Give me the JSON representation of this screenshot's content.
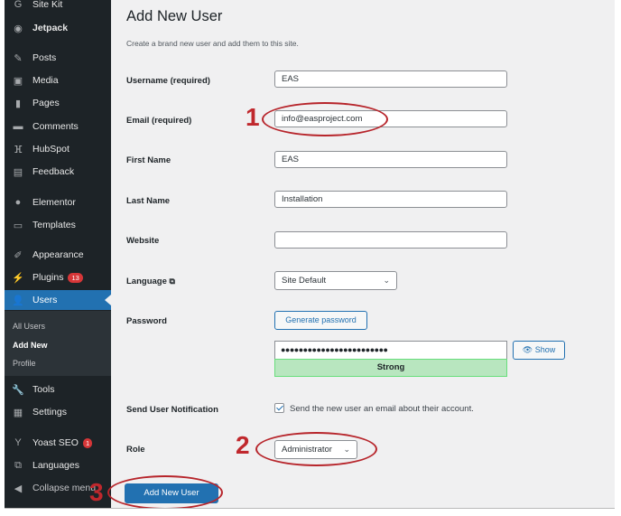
{
  "sidebar": {
    "items": [
      {
        "label": "Site Kit",
        "icon": "google-g-icon"
      },
      {
        "label": "Jetpack",
        "icon": "jetpack-icon"
      },
      {
        "label": "Posts",
        "icon": "pin-icon"
      },
      {
        "label": "Media",
        "icon": "media-icon"
      },
      {
        "label": "Pages",
        "icon": "pages-icon"
      },
      {
        "label": "Comments",
        "icon": "comment-icon"
      },
      {
        "label": "HubSpot",
        "icon": "hubspot-icon"
      },
      {
        "label": "Feedback",
        "icon": "feedback-icon"
      },
      {
        "label": "Elementor",
        "icon": "elementor-icon"
      },
      {
        "label": "Templates",
        "icon": "folder-icon"
      },
      {
        "label": "Appearance",
        "icon": "brush-icon"
      },
      {
        "label": "Plugins",
        "icon": "plugin-icon",
        "badge": "13"
      },
      {
        "label": "Users",
        "icon": "user-icon",
        "active": true
      },
      {
        "label": "Tools",
        "icon": "wrench-icon"
      },
      {
        "label": "Settings",
        "icon": "settings-icon"
      },
      {
        "label": "Yoast SEO",
        "icon": "yoast-icon",
        "badge": "1"
      },
      {
        "label": "Languages",
        "icon": "translate-icon"
      },
      {
        "label": "Collapse menu",
        "icon": "collapse-icon"
      }
    ],
    "submenu": [
      {
        "label": "All Users"
      },
      {
        "label": "Add New",
        "current": true
      },
      {
        "label": "Profile"
      }
    ]
  },
  "page": {
    "title": "Add New User",
    "description": "Create a brand new user and add them to this site."
  },
  "form": {
    "username": {
      "label": "Username (required)",
      "value": "EAS"
    },
    "email": {
      "label": "Email (required)",
      "value": "info@easproject.com"
    },
    "first_name": {
      "label": "First Name",
      "value": "EAS"
    },
    "last_name": {
      "label": "Last Name",
      "value": "Installation"
    },
    "website": {
      "label": "Website",
      "value": ""
    },
    "language": {
      "label": "Language",
      "value": "Site Default"
    },
    "password": {
      "label": "Password",
      "generate_label": "Generate password",
      "masked_value": "●●●●●●●●●●●●●●●●●●●●●●●●",
      "show_label": "Show",
      "strength": "Strong"
    },
    "notification": {
      "label": "Send User Notification",
      "checkbox_label": "Send the new user an email about their account.",
      "checked": true
    },
    "role": {
      "label": "Role",
      "value": "Administrator"
    },
    "submit_label": "Add New User"
  },
  "annotations": [
    "1",
    "2",
    "3"
  ],
  "colors": {
    "sidebar_bg": "#1d2327",
    "accent": "#2271b1",
    "strength_bg": "#b8e6bf",
    "annotation_red": "#c0282d"
  }
}
